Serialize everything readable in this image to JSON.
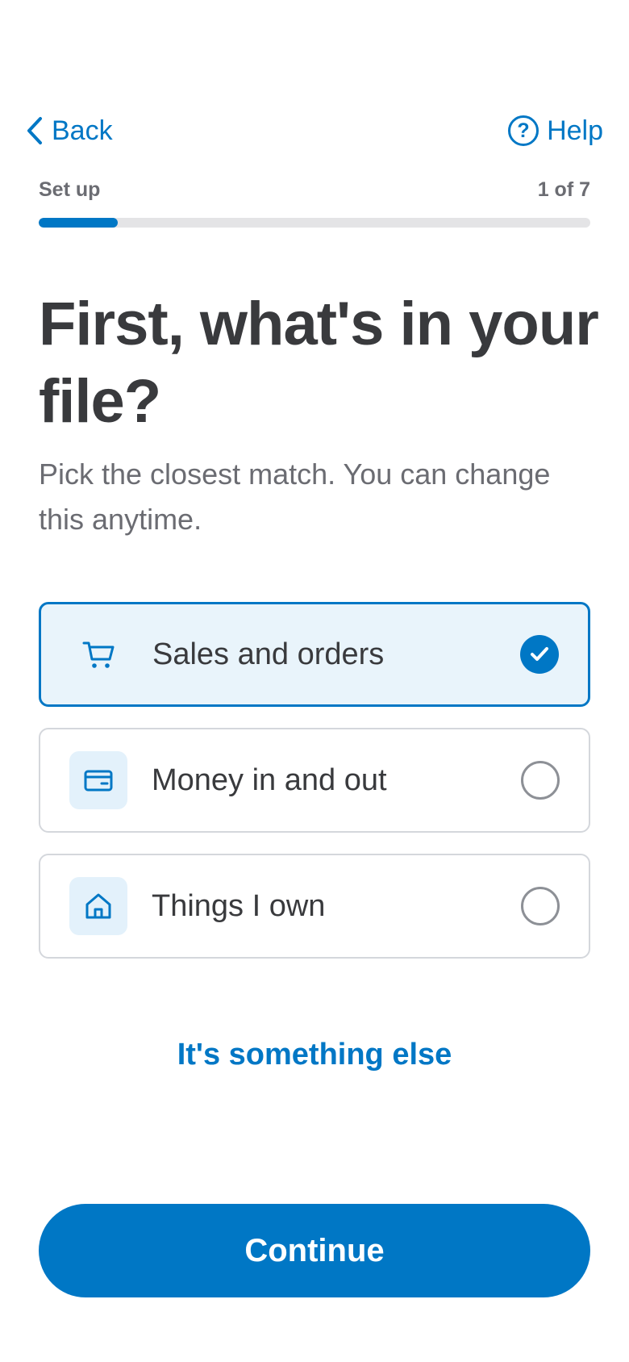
{
  "nav": {
    "back_label": "Back",
    "help_label": "Help",
    "help_icon_glyph": "?"
  },
  "step": {
    "label": "Set up",
    "counter": "1 of 7",
    "progress_fraction": 0.143
  },
  "page": {
    "title": "First, what's in your file?",
    "subtitle": "Pick the closest match. You can change this anytime."
  },
  "options": [
    {
      "label": "Sales and orders",
      "icon": "shopping-cart-icon",
      "selected": true
    },
    {
      "label": "Money in and out",
      "icon": "wallet-icon",
      "selected": false
    },
    {
      "label": "Things I own",
      "icon": "home-icon",
      "selected": false
    }
  ],
  "links": {
    "something_else": "It's something else"
  },
  "actions": {
    "continue_label": "Continue"
  },
  "colors": {
    "accent": "#0077c5",
    "selected_bg": "#e9f4fb",
    "text": "#393a3d",
    "muted": "#6b6c72"
  }
}
